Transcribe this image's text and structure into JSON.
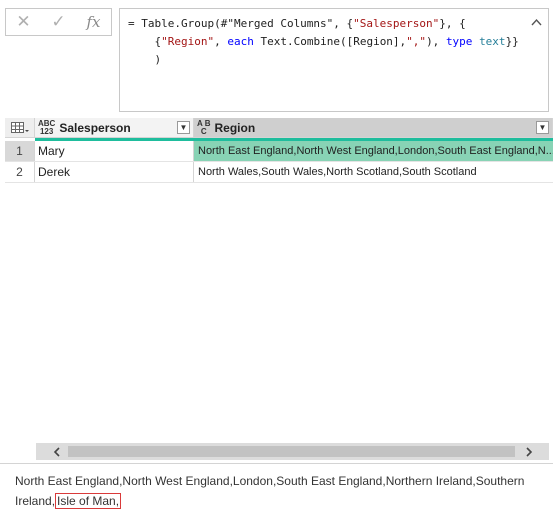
{
  "formula_bar": {
    "icons": [
      "cancel-icon",
      "commit-icon",
      "fx-icon"
    ],
    "line1_a": "= Table.Group(#\"Merged Columns\", {",
    "line1_str": "\"Salesperson\"",
    "line1_b": "}, {",
    "line2_a": "    {",
    "line2_str1": "\"Region\"",
    "line2_b": ", ",
    "line2_kw1": "each",
    "line2_c": " Text.Combine([Region],",
    "line2_str2": "\",\"",
    "line2_d": "), ",
    "line2_kw2": "type",
    "line2_e": " ",
    "line2_ty": "text",
    "line2_f": "}}",
    "line3": "    )",
    "collapse_glyph": "^"
  },
  "grid": {
    "columns": [
      {
        "type_top": "ABC",
        "type_bottom": "123",
        "title": "Salesperson"
      },
      {
        "type_top": "A B",
        "type_bottom": "C",
        "title": "Region"
      }
    ],
    "rows": [
      {
        "index": "1",
        "salesperson": "Mary",
        "region": "North East England,North West England,London,South East England,N..."
      },
      {
        "index": "2",
        "salesperson": "Derek",
        "region": "North Wales,South Wales,North Scotland,South Scotland"
      }
    ],
    "selected_row": 0,
    "accent_color": "#1fbd9d"
  },
  "preview": {
    "text": "North East England,North West England,London,South East England,Northern Ireland,Southern Ireland,",
    "highlighted": "Isle of Man,"
  }
}
